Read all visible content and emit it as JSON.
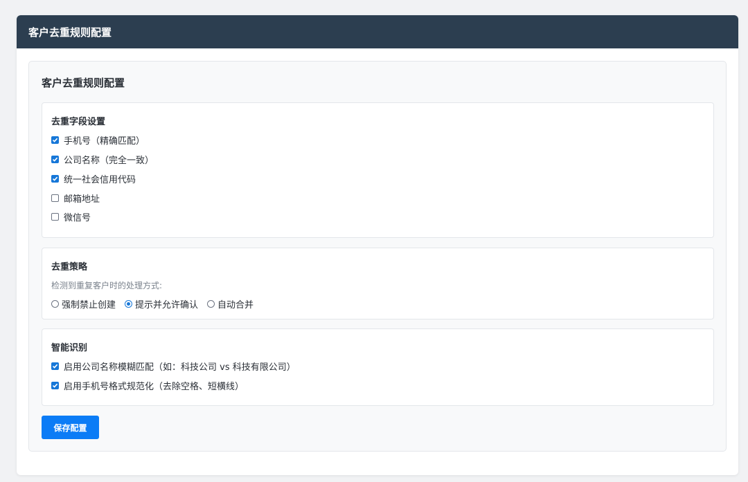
{
  "window": {
    "title": "客户去重规则配置"
  },
  "panel": {
    "title": "客户去重规则配置"
  },
  "fields_section": {
    "title": "去重字段设置",
    "items": [
      {
        "label": "手机号（精确匹配）",
        "checked": true
      },
      {
        "label": "公司名称（完全一致）",
        "checked": true
      },
      {
        "label": "统一社会信用代码",
        "checked": true
      },
      {
        "label": "邮箱地址",
        "checked": false
      },
      {
        "label": "微信号",
        "checked": false
      }
    ]
  },
  "strategy_section": {
    "title": "去重策略",
    "hint": "检测到重复客户时的处理方式:",
    "options": [
      {
        "label": "强制禁止创建",
        "selected": false
      },
      {
        "label": "提示并允许确认",
        "selected": true
      },
      {
        "label": "自动合并",
        "selected": false
      }
    ]
  },
  "smart_section": {
    "title": "智能识别",
    "items": [
      {
        "label": "启用公司名称模糊匹配（如：科技公司 vs 科技有限公司）",
        "checked": true
      },
      {
        "label": "启用手机号格式规范化（去除空格、短横线）",
        "checked": true
      }
    ]
  },
  "save_button": {
    "label": "保存配置"
  },
  "colors": {
    "header_bg": "#2c3e50",
    "accent": "#0b7cf6",
    "checkbox_on": "#1677d8"
  }
}
